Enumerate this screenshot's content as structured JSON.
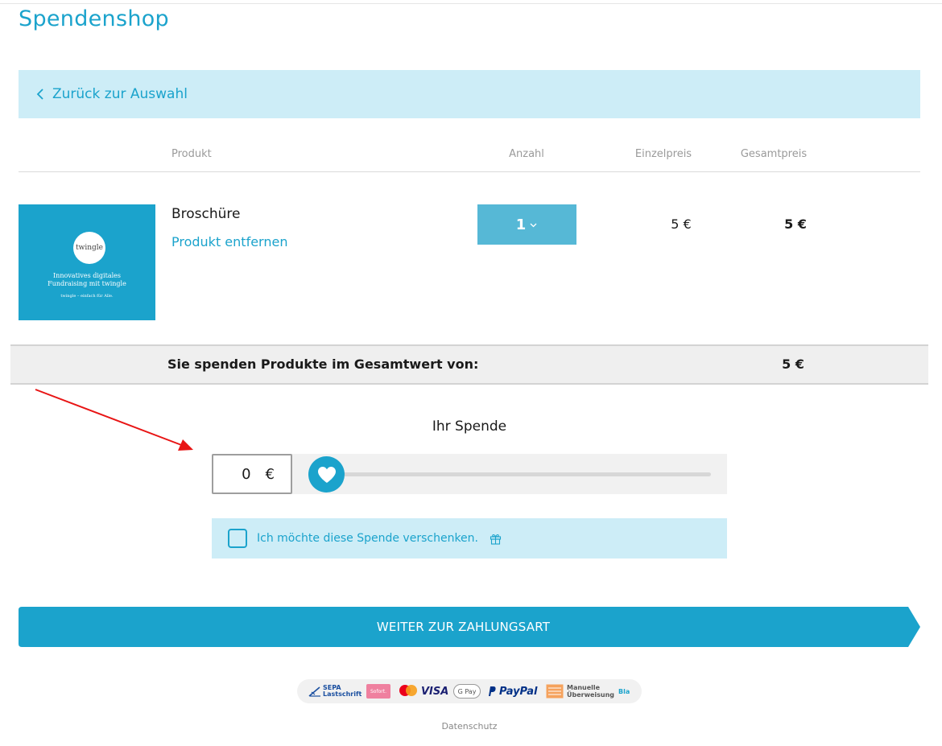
{
  "shop": {
    "title": "Spendenshop"
  },
  "nav": {
    "back_label": "Zurück zur Auswahl"
  },
  "table": {
    "headers": {
      "product": "Produkt",
      "quantity": "Anzahl",
      "unit_price": "Einzelpreis",
      "total_price": "Gesamtpreis"
    }
  },
  "cart_item": {
    "name": "Broschüre",
    "remove_label": "Produkt entfernen",
    "quantity": "1",
    "unit_price": "5 €",
    "total_price": "5 €",
    "image": {
      "logo_text": "twingle",
      "line1": "Innovatives digitales Fundraising mit twingle",
      "line2": "twingle – einfach für Alle."
    }
  },
  "summary": {
    "label": "Sie spenden Produkte im Gesamtwert von:",
    "value": "5 €"
  },
  "donation": {
    "title": "Ihr Spende",
    "amount": "0",
    "currency": "€",
    "slider_level": 0
  },
  "gift": {
    "label": "Ich möchte diese Spende verschenken.",
    "checked": false
  },
  "cta": {
    "label": "WEITER ZUR ZAHLUNGSART"
  },
  "payment_methods": {
    "sepa_line1": "SEPA",
    "sepa_line2": "Lastschrift",
    "sofort": "Sofort.",
    "visa": "VISA",
    "gpay": "G Pay",
    "paypal": "PayPal",
    "manuell_line1": "Manuelle",
    "manuell_line2": "Überweisung",
    "more": "Bla"
  },
  "footer": {
    "privacy": "Datenschutz"
  },
  "colors": {
    "brand": "#1ba3cc",
    "light_brand": "#cdedf7",
    "qty_button": "#56b8d6",
    "summary_bg": "#efefef"
  }
}
